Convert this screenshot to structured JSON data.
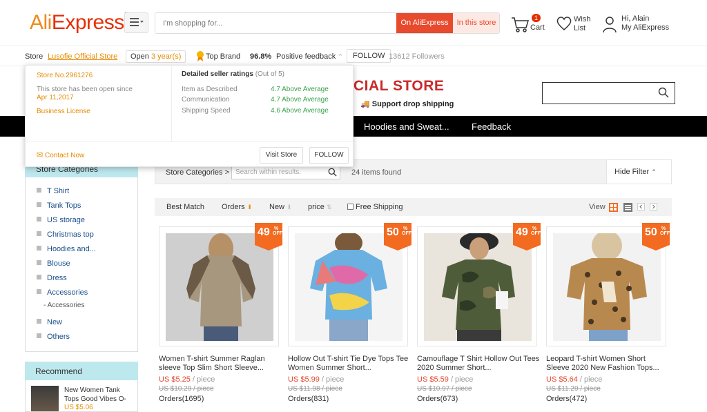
{
  "header": {
    "logo_ali": "Ali",
    "logo_express": "Express",
    "search_placeholder": "I'm shopping for...",
    "btn_on": "On AliExpress",
    "btn_in": "In this store",
    "cart_count": "1",
    "cart_label": "Cart",
    "wish_label1": "Wish",
    "wish_label2": "List",
    "user_hi": "Hi, Alain",
    "user_my": "My AliExpress"
  },
  "storebar": {
    "store_label": "Store",
    "store_name": "Lusofie Official Store",
    "open_prefix": "Open",
    "open_years": "3 year(s)",
    "top_brand": "Top Brand",
    "feedback_pct": "96.8%",
    "feedback_label": "Positive feedback",
    "follow": "FOLLOW",
    "followers": "13612 Followers"
  },
  "banner": {
    "title": "CIAL STORE",
    "sub": "Support drop shipping"
  },
  "nav": {
    "hoodies": "Hoodies and Sweat...",
    "feedback": "Feedback"
  },
  "popup": {
    "store_no": "Store No.2961276",
    "open_since": "This store has been open since",
    "open_date": "Apr 11,2017",
    "license": "Business License",
    "ratings_title": "Detailed seller ratings",
    "ratings_sub": "(Out of 5)",
    "r1_label": "Item as Described",
    "r1_value": "4.7 Above Average",
    "r2_label": "Communication",
    "r2_value": "4.7 Above Average",
    "r3_label": "Shipping Speed",
    "r3_value": "4.6 Above Average",
    "contact": "Contact Now",
    "visit": "Visit Store",
    "follow": "FOLLOW"
  },
  "sidebar": {
    "head": "Store Categories",
    "items": [
      "T Shirt",
      "Tank Tops",
      "US storage",
      "Christmas top",
      "Hoodies and...",
      "Blouse",
      "Dress",
      "Accessories",
      "New",
      "Others"
    ],
    "sub_accessories": "Accessories",
    "recommend": "Recommend",
    "rec_name": "New Women Tank Tops Good Vibes O-",
    "rec_price": "US $5.06"
  },
  "filter": {
    "categories": "Store Categories >",
    "search_placeholder": "Search within results.",
    "found": "24 items found",
    "hide": "Hide Filter"
  },
  "sort": {
    "best": "Best Match",
    "orders": "Orders",
    "new": "New",
    "price": "price",
    "free": "Free Shipping",
    "view": "View"
  },
  "products": [
    {
      "discount": "49",
      "name": "Women T-shirt Summer Raglan sleeve Top Slim Short Sleeve...",
      "price": "US $5.25",
      "unit": " / piece",
      "old": "US $10.29 / piece",
      "orders": "Orders(1695)"
    },
    {
      "discount": "50",
      "name": "Hollow Out T-shirt Tie Dye Tops Tee Women Summer Short...",
      "price": "US $5.99",
      "unit": " / piece",
      "old": "US $11.98 / piece",
      "orders": "Orders(831)"
    },
    {
      "discount": "49",
      "name": "Camouflage T Shirt Hollow Out Tees 2020 Summer Short...",
      "price": "US $5.59",
      "unit": " / piece",
      "old": "US $10.97 / piece",
      "orders": "Orders(673)"
    },
    {
      "discount": "50",
      "name": "Leopard T-shirt Women Short Sleeve 2020 New Fashion Tops...",
      "price": "US $5.64",
      "unit": " / piece",
      "old": "US $11.29 / piece",
      "orders": "Orders(472)"
    }
  ],
  "badge_off": "OFF",
  "badge_pct": "%",
  "colors": {
    "accent": "#e84a2e",
    "orange": "#e68a00",
    "badge": "#f26b21",
    "green": "#3aa14a",
    "nav": "#000000",
    "cat_head": "#bde8ee"
  }
}
